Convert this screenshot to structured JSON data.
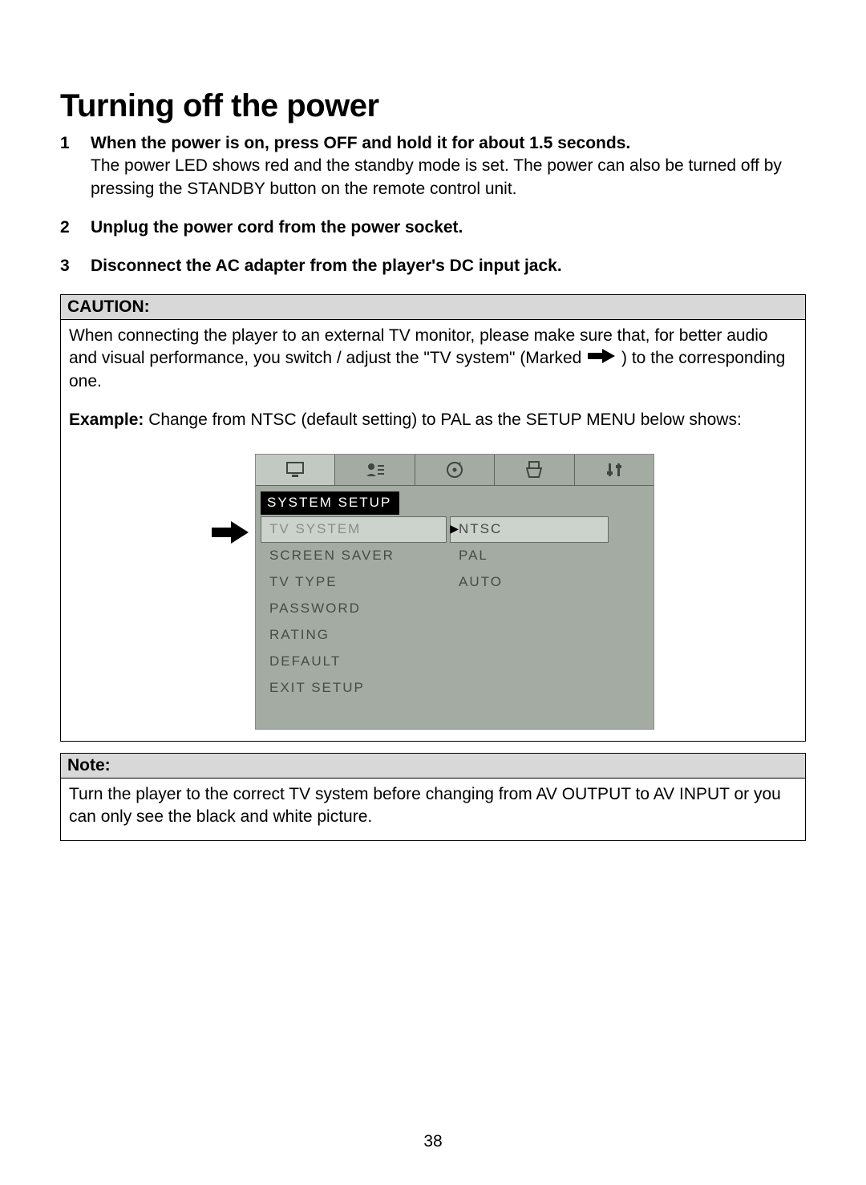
{
  "title": "Turning off the power",
  "steps": [
    {
      "num": "1",
      "head": "When the power is on, press OFF and hold it for about 1.5 seconds.",
      "desc": "The power LED shows red and the standby mode is set. The power can also be turned off by pressing the STANDBY button on the remote control unit."
    },
    {
      "num": "2",
      "head": "Unplug the power cord from the power socket.",
      "desc": ""
    },
    {
      "num": "3",
      "head": "Disconnect the AC adapter from the player's DC input jack.",
      "desc": ""
    }
  ],
  "caution": {
    "label": "CAUTION:",
    "text_pre": "When connecting the player to an external TV monitor, please make sure that, for better audio and visual performance, you switch / adjust the \"TV system\" (Marked ",
    "text_post": " ) to the corresponding one.",
    "example_label": "Example:",
    "example_text": " Change from NTSC (default setting) to PAL as the SETUP MENU below shows:"
  },
  "osd": {
    "panel_title": "SYSTEM SETUP",
    "menu_items": [
      "TV SYSTEM",
      "SCREEN SAVER",
      "TV TYPE",
      "PASSWORD",
      "RATING",
      "DEFAULT",
      "EXIT SETUP"
    ],
    "selected_menu_index": 0,
    "value_items": [
      "NTSC",
      "PAL",
      "AUTO"
    ],
    "selected_value_index": 0
  },
  "note": {
    "label": "Note:",
    "text": "Turn the player to the correct TV system before changing from AV OUTPUT to AV INPUT or you can only see the black and white picture."
  },
  "page_number": "38"
}
